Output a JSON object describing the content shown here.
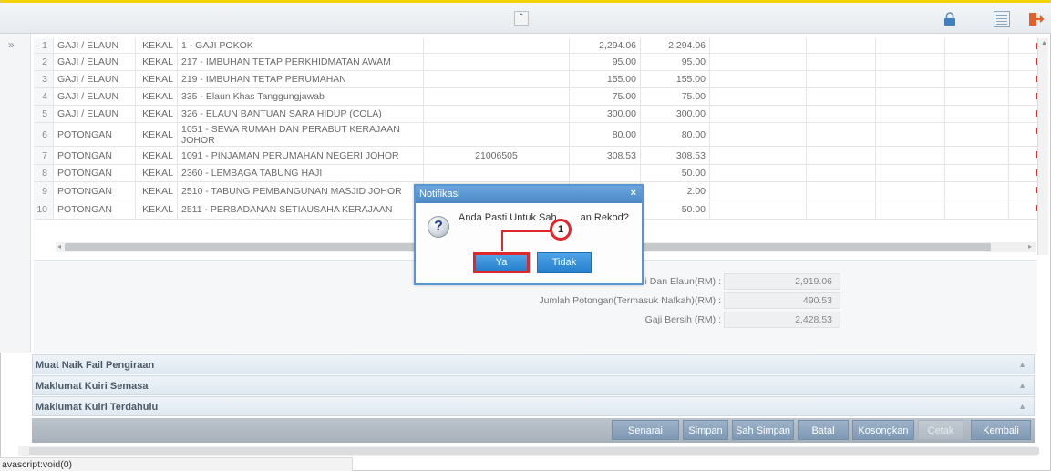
{
  "toolbar": {
    "collapse": "⌃"
  },
  "sidebar": {
    "expand": "»"
  },
  "grid": {
    "rows": [
      {
        "no": "1",
        "jenis": "GAJI / ELAUN",
        "kategori": "KEKAL",
        "keterangan": "1 - GAJI POKOK",
        "rujukan": "",
        "amaun1": "2,294.06",
        "amaun2": "2,294.06"
      },
      {
        "no": "2",
        "jenis": "GAJI / ELAUN",
        "kategori": "KEKAL",
        "keterangan": "217 - IMBUHAN TETAP PERKHIDMATAN AWAM",
        "rujukan": "",
        "amaun1": "95.00",
        "amaun2": "95.00"
      },
      {
        "no": "3",
        "jenis": "GAJI / ELAUN",
        "kategori": "KEKAL",
        "keterangan": "219 - IMBUHAN TETAP PERUMAHAN",
        "rujukan": "",
        "amaun1": "155.00",
        "amaun2": "155.00"
      },
      {
        "no": "4",
        "jenis": "GAJI / ELAUN",
        "kategori": "KEKAL",
        "keterangan": "335 - Elaun Khas Tanggungjawab",
        "rujukan": "",
        "amaun1": "75.00",
        "amaun2": "75.00"
      },
      {
        "no": "5",
        "jenis": "GAJI / ELAUN",
        "kategori": "KEKAL",
        "keterangan": "326 - ELAUN BANTUAN SARA HIDUP (COLA)",
        "rujukan": "",
        "amaun1": "300.00",
        "amaun2": "300.00"
      },
      {
        "no": "6",
        "jenis": "POTONGAN",
        "kategori": "KEKAL",
        "keterangan": "1051 - SEWA RUMAH DAN PERABUT KERAJAAN JOHOR",
        "rujukan": "",
        "amaun1": "80.00",
        "amaun2": "80.00"
      },
      {
        "no": "7",
        "jenis": "POTONGAN",
        "kategori": "KEKAL",
        "keterangan": "1091 - PINJAMAN PERUMAHAN NEGERI JOHOR",
        "rujukan": "21006505",
        "amaun1": "308.53",
        "amaun2": "308.53"
      },
      {
        "no": "8",
        "jenis": "POTONGAN",
        "kategori": "KEKAL",
        "keterangan": "2360 - LEMBAGA TABUNG HAJI",
        "rujukan": "",
        "amaun1": "",
        "amaun2": "50.00"
      },
      {
        "no": "9",
        "jenis": "POTONGAN",
        "kategori": "KEKAL",
        "keterangan": "2510 - TABUNG PEMBANGUNAN MASJID JOHOR",
        "rujukan": "",
        "amaun1": "",
        "amaun2": "2.00"
      },
      {
        "no": "10",
        "jenis": "POTONGAN",
        "kategori": "KEKAL",
        "keterangan": "2511 - PERBADANAN SETIAUSAHA KERAJAAN",
        "rujukan": "",
        "amaun1": "",
        "amaun2": "50.00"
      }
    ]
  },
  "summary": {
    "gaji_label": "i Dan Elaun(RM) :",
    "gaji_value": "2,919.06",
    "potongan_label": "Jumlah Potongan(Termasuk Nafkah)(RM) :",
    "potongan_value": "490.53",
    "bersih_label": "Gaji Bersih (RM) :",
    "bersih_value": "2,428.53"
  },
  "sections": {
    "muat_naik": "Muat Naik Fail Pengiraan",
    "kuiri_semasa": "Maklumat Kuiri Semasa",
    "kuiri_terdahulu": "Maklumat Kuiri Terdahulu"
  },
  "buttons": {
    "senarai_semak": "Senarai Semak",
    "simpan": "Simpan",
    "sah_simpan": "Sah Simpan",
    "batal": "Batal",
    "kosongkan": "Kosongkan",
    "cetak": "Cetak",
    "kembali": "Kembali"
  },
  "dialog": {
    "title": "Notifikasi",
    "close": "×",
    "message": "Anda Pasti Untuk Sah",
    "message_tail": "an Rekod?",
    "yes": "Ya",
    "no": "Tidak"
  },
  "callout": {
    "number": "1"
  },
  "status": {
    "text": "avascript:void(0)"
  }
}
